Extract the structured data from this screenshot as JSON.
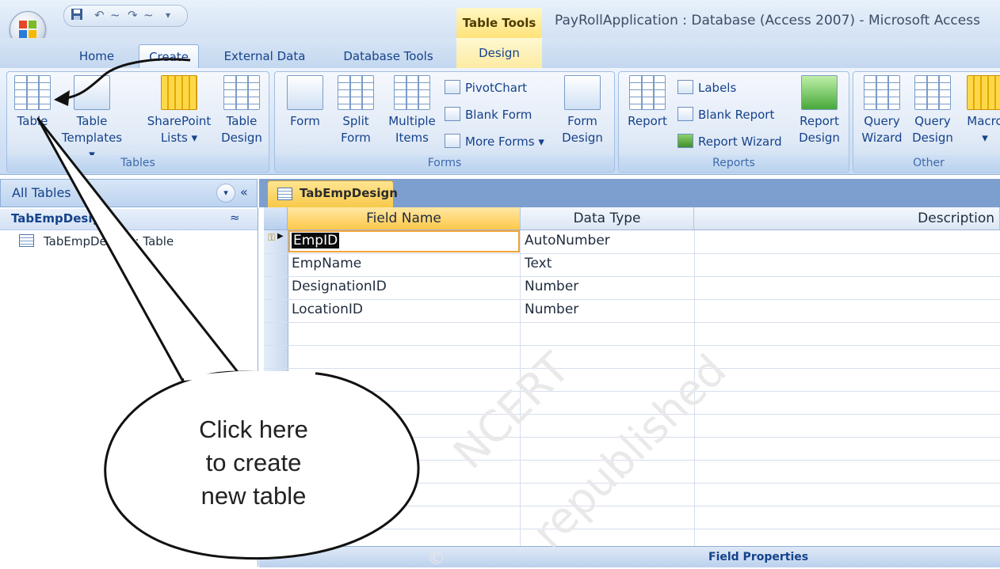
{
  "window": {
    "context_tab": "Table Tools",
    "title": "PayRollApplication : Database (Access 2007) - Microsoft Access"
  },
  "tabs": [
    {
      "label": "Home"
    },
    {
      "label": "Create",
      "active": true
    },
    {
      "label": "External Data"
    },
    {
      "label": "Database Tools"
    },
    {
      "label": "Design",
      "contextual": true
    }
  ],
  "ribbon": {
    "groups": {
      "tables": {
        "label": "Tables",
        "buttons": [
          "Table",
          "Table\nTemplates ▾",
          "SharePoint\nLists ▾",
          "Table\nDesign"
        ]
      },
      "forms": {
        "label": "Forms",
        "buttons": [
          "Form",
          "Split\nForm",
          "Multiple\nItems",
          "Form\nDesign"
        ],
        "small": [
          "PivotChart",
          "Blank Form",
          "More Forms ▾"
        ]
      },
      "reports": {
        "label": "Reports",
        "buttons": [
          "Report",
          "Report\nDesign"
        ],
        "small": [
          "Labels",
          "Blank Report",
          "Report Wizard"
        ]
      },
      "other": {
        "label": "Other",
        "buttons": [
          "Query\nWizard",
          "Query\nDesign",
          "Macro\n▾"
        ]
      }
    }
  },
  "nav_pane": {
    "header": "All Tables",
    "group": "TabEmpDesign",
    "items": [
      "TabEmpDesign : Table"
    ]
  },
  "document": {
    "tab": "TabEmpDesign",
    "columns": [
      "Field Name",
      "Data Type",
      "Description"
    ],
    "rows": [
      {
        "field": "EmpID",
        "type": "AutoNumber",
        "primary_key": true
      },
      {
        "field": "EmpName",
        "type": "Text"
      },
      {
        "field": "DesignationID",
        "type": "Number"
      },
      {
        "field": "LocationID",
        "type": "Number"
      }
    ],
    "field_properties": "Field Properties"
  },
  "annotation": {
    "callout": "Click here\nto create\nnew table"
  },
  "watermark": {
    "line1": "NCERT",
    "line2": "republished",
    "mark": "©"
  },
  "colors": {
    "accent_blue": "#15428b",
    "tab_highlight": "#ffc84a",
    "ribbon_bg": "#d7e5f6"
  }
}
